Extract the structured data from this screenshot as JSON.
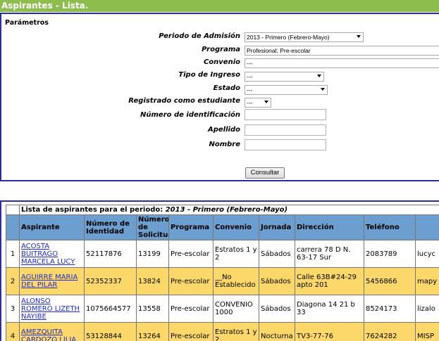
{
  "window": {
    "title": "Aspirantes - Lista."
  },
  "params": {
    "section_title": "Parámetros",
    "periodo_label": "Periodo de Admisión",
    "periodo_value": "2013 - Primero (Febrero-Mayo)",
    "programa_label": "Programa",
    "programa_value": "Profesional: Pre-escolar",
    "convenio_label": "Convenio",
    "convenio_value": "---",
    "tipo_label": "Tipo de Ingreso",
    "tipo_value": "---",
    "estado_label": "Estado",
    "estado_value": "---",
    "registrado_label": "Registrado como estudiante",
    "registrado_value": "---",
    "numero_label": "Número de identificación",
    "apellido_label": "Apellido",
    "nombre_label": "Nombre",
    "submit_label": "Consultar"
  },
  "results": {
    "caption_prefix": "Lista de aspirantes para el periodo:",
    "caption_period": "2013 - Primero (Febrero-Mayo)",
    "columns": [
      "Aspirante",
      "Número de Identidad",
      "Número de Solicitud",
      "Programa",
      "Convenio",
      "Jornada",
      "Dirección",
      "Teléfono",
      ""
    ],
    "rows": [
      {
        "idx": "1",
        "name": "ACOSTA BUITRAGO MARCELA LUCY",
        "id": "52117876",
        "sol": "13199",
        "prog": "Pre-escolar",
        "conv": "Estratos 1 y 2",
        "jor": "Sábados",
        "dir": "carrera 78 D N. 63-17 Sur",
        "tel": "2083789",
        "extra": "lucyc"
      },
      {
        "idx": "2",
        "name": "AGUIRRE MARIA DEL PILAR",
        "id": "52352337",
        "sol": "13824",
        "prog": "Pre-escolar",
        "conv": "__No Establecido",
        "jor": "Sábados",
        "dir": "Calle 63B#24-29 apto 201",
        "tel": "5456866",
        "extra": "mapy"
      },
      {
        "idx": "3",
        "name": "ALONSO ROMERO LIZETH NAYIBE",
        "id": "1075664577",
        "sol": "13558",
        "prog": "Pre-escolar",
        "conv": "CONVENIO 1000",
        "jor": "Sábados",
        "dir": "Diagona 14 21 b 33",
        "tel": "8524173",
        "extra": "lizalo"
      },
      {
        "idx": "4",
        "name": "AMEZQUITA CARDOZO LILIA",
        "id": "53128844",
        "sol": "13264",
        "prog": "Pre-escolar",
        "conv": "Estratos 1 y 2",
        "jor": "Nocturna",
        "dir": "TV3-77-76",
        "tel": "7624282",
        "extra": "MISP"
      }
    ]
  }
}
